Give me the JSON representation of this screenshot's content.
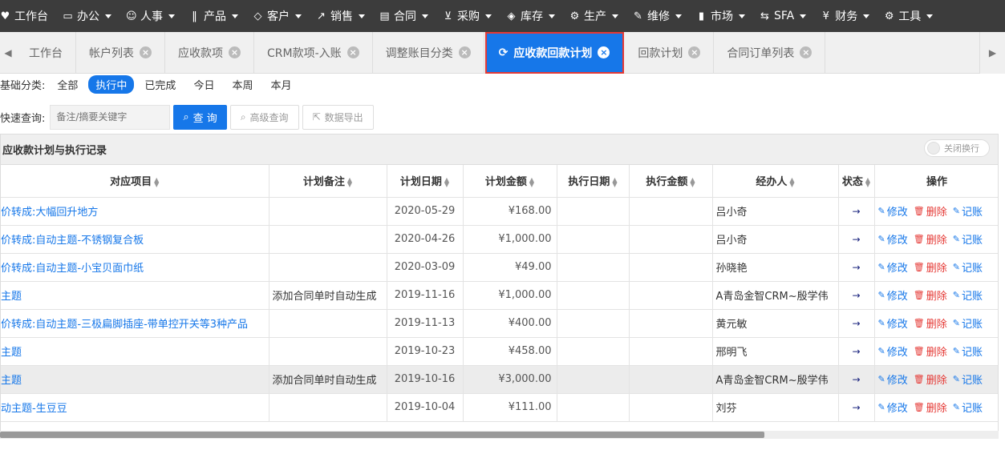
{
  "topnav": {
    "items": [
      {
        "label": "工作台",
        "icon": "heart-icon",
        "glyph": "♥",
        "dropdown": false
      },
      {
        "label": "办公",
        "icon": "monitor-icon",
        "glyph": "▭",
        "dropdown": true
      },
      {
        "label": "人事",
        "icon": "users-icon",
        "glyph": "☺",
        "dropdown": true
      },
      {
        "label": "产品",
        "icon": "barcode-icon",
        "glyph": "‖",
        "dropdown": true
      },
      {
        "label": "客户",
        "icon": "diamond-icon",
        "glyph": "◇",
        "dropdown": true
      },
      {
        "label": "销售",
        "icon": "line-chart-icon",
        "glyph": "↗",
        "dropdown": true
      },
      {
        "label": "合同",
        "icon": "contract-icon",
        "glyph": "▤",
        "dropdown": true
      },
      {
        "label": "采购",
        "icon": "cart-icon",
        "glyph": "⊻",
        "dropdown": true
      },
      {
        "label": "库存",
        "icon": "cubes-icon",
        "glyph": "◈",
        "dropdown": true
      },
      {
        "label": "生产",
        "icon": "gears-icon",
        "glyph": "⚙",
        "dropdown": true
      },
      {
        "label": "维修",
        "icon": "wrench-icon",
        "glyph": "✎",
        "dropdown": true
      },
      {
        "label": "市场",
        "icon": "bookmark-icon",
        "glyph": "▮",
        "dropdown": true
      },
      {
        "label": "SFA",
        "icon": "exchange-icon",
        "glyph": "⇆",
        "dropdown": true
      },
      {
        "label": "财务",
        "icon": "yen-icon",
        "glyph": "¥",
        "dropdown": true
      },
      {
        "label": "工具",
        "icon": "gear-icon",
        "glyph": "⚙",
        "dropdown": true
      }
    ]
  },
  "tabs": [
    {
      "label": "工作台",
      "closable": false,
      "active": false
    },
    {
      "label": "帐户列表",
      "closable": true,
      "active": false
    },
    {
      "label": "应收款项",
      "closable": true,
      "active": false
    },
    {
      "label": "CRM款项-入账",
      "closable": true,
      "active": false
    },
    {
      "label": "调整账目分类",
      "closable": true,
      "active": false
    },
    {
      "label": "应收款回款计划",
      "closable": true,
      "active": true
    },
    {
      "label": "回款计划",
      "closable": true,
      "active": false
    },
    {
      "label": "合同订单列表",
      "closable": true,
      "active": false
    }
  ],
  "filter": {
    "label": "基础分类:",
    "options": [
      "全部",
      "执行中",
      "已完成",
      "今日",
      "本周",
      "本月"
    ],
    "selected": "执行中"
  },
  "search": {
    "label": "快速查询:",
    "placeholder": "备注/摘要关键字",
    "query_button": "查 询",
    "advanced_button": "高级查询",
    "export_button": "数据导出"
  },
  "panel": {
    "title": "应收款计划与执行记录",
    "toggle_label": "关闭换行"
  },
  "table": {
    "columns": [
      "对应项目",
      "计划备注",
      "计划日期",
      "计划金额",
      "执行日期",
      "执行金额",
      "经办人",
      "状态",
      "操作"
    ],
    "actions": {
      "edit": "修改",
      "delete": "删除",
      "record": "记账"
    },
    "rows": [
      {
        "project": "价转成:大幅回升地方",
        "note": "",
        "plan_date": "2020-05-29",
        "plan_amount": "¥168.00",
        "exec_date": "",
        "exec_amount": "",
        "handler": "吕小奇",
        "status": "→"
      },
      {
        "project": "价转成:自动主题-不锈钢复合板",
        "note": "",
        "plan_date": "2020-04-26",
        "plan_amount": "¥1,000.00",
        "exec_date": "",
        "exec_amount": "",
        "handler": "吕小奇",
        "status": "→"
      },
      {
        "project": "价转成:自动主题-小宝贝面巾纸",
        "note": "",
        "plan_date": "2020-03-09",
        "plan_amount": "¥49.00",
        "exec_date": "",
        "exec_amount": "",
        "handler": "孙晓艳",
        "status": "→"
      },
      {
        "project": "主题",
        "note": "添加合同单时自动生成",
        "plan_date": "2019-11-16",
        "plan_amount": "¥1,000.00",
        "exec_date": "",
        "exec_amount": "",
        "handler": "A青岛金智CRM~殷学伟",
        "status": "→"
      },
      {
        "project": "价转成:自动主题-三极扁脚插座-带单控开关等3种产品",
        "note": "",
        "plan_date": "2019-11-13",
        "plan_amount": "¥400.00",
        "exec_date": "",
        "exec_amount": "",
        "handler": "黄元敏",
        "status": "→"
      },
      {
        "project": "主题",
        "note": "",
        "plan_date": "2019-10-23",
        "plan_amount": "¥458.00",
        "exec_date": "",
        "exec_amount": "",
        "handler": "邢明飞",
        "status": "→"
      },
      {
        "project": "主题",
        "note": "添加合同单时自动生成",
        "plan_date": "2019-10-16",
        "plan_amount": "¥3,000.00",
        "exec_date": "",
        "exec_amount": "",
        "handler": "A青岛金智CRM~殷学伟",
        "status": "→"
      },
      {
        "project": "动主题-生豆豆",
        "note": "",
        "plan_date": "2019-10-04",
        "plan_amount": "¥111.00",
        "exec_date": "",
        "exec_amount": "",
        "handler": "刘芬",
        "status": "→"
      }
    ]
  },
  "colors": {
    "nav_bg": "#3c3c3c",
    "accent": "#1677e9",
    "danger": "#e53935",
    "highlight_row": "#ececec"
  }
}
